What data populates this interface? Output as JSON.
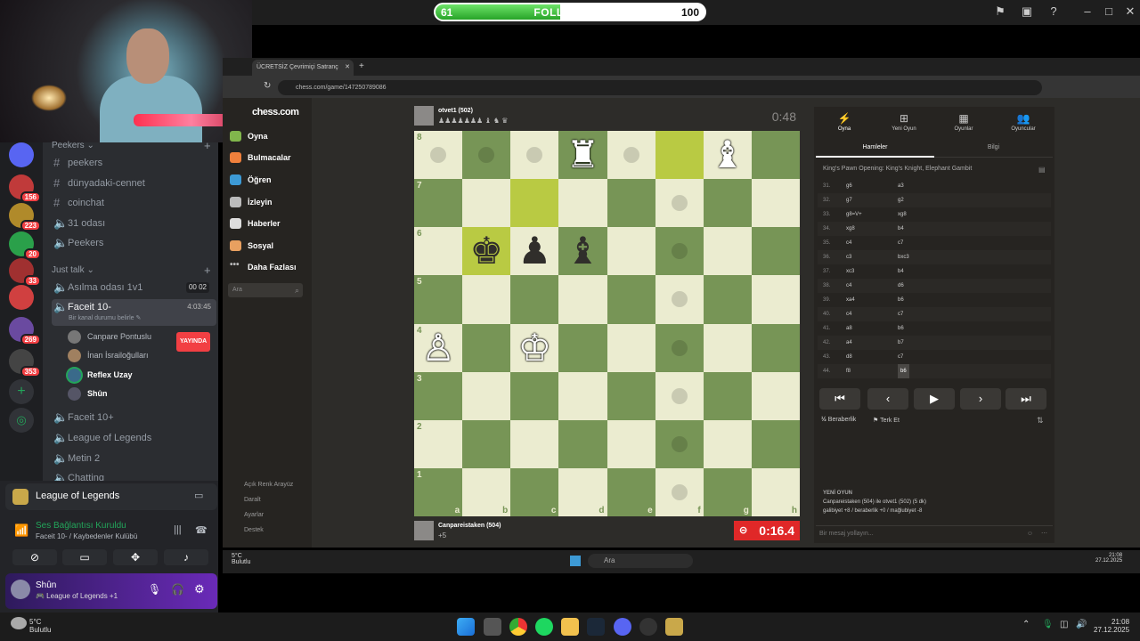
{
  "overlay": {
    "followers_min": "61",
    "followers_label": "FOLLOWERS",
    "followers_max": "100",
    "followers_progress": 0.465,
    "bar_colors": {
      "fill": "#4cc34a",
      "border": "#ffffff"
    }
  },
  "discord": {
    "categories": [
      {
        "label": "Peekers ⌄"
      },
      {
        "label": "Just talk ⌄"
      }
    ],
    "text_channels": [
      "peekers",
      "dünyadaki-cennet",
      "coinchat",
      "31 odası",
      "Peekers"
    ],
    "voice_channels_top": [
      {
        "label": "Asılma odası 1v1",
        "count_a": "00",
        "count_b": "02"
      },
      {
        "label": "Faceit 10-",
        "timer": "4:03:45",
        "status": "Bir kanal durumu belirle ✎"
      }
    ],
    "voice_users": [
      {
        "name": "Canpare Pontuslu",
        "live": "YAYINDA"
      },
      {
        "name": "İnan İsrailoğulları"
      },
      {
        "name": "Reflex Uzay"
      },
      {
        "name": "Shûn"
      }
    ],
    "voice_channels_bottom": [
      "Faceit 10+",
      "League of Legends",
      "Metin 2",
      "Chatting"
    ],
    "server_badges": [
      "156",
      "223",
      "20",
      "33",
      "269",
      "353"
    ],
    "activity": "League of Legends",
    "connection": {
      "title": "Ses Bağlantısı Kuruldu",
      "subtitle": "Faceit 10- / Kaybedenler Kulübü"
    },
    "user": {
      "name": "Shûn",
      "status": "🎮 League of Legends +1"
    }
  },
  "browser": {
    "tab_title": "ÜCRETSİZ Çevrimiçi Satranç",
    "url": "chess.com/game/147250789086"
  },
  "chess_nav": {
    "logo": "chess.com",
    "items": [
      "Oyna",
      "Bulmacalar",
      "Öğren",
      "İzleyin",
      "Haberler",
      "Sosyal",
      "Daha Fazlası"
    ],
    "search_placeholder": "Ara",
    "bottom": [
      "Açık Renk Arayüz",
      "Daralt",
      "Ayarlar",
      "Destek"
    ]
  },
  "game": {
    "top_player": {
      "name": "otvet1 (502)",
      "material": "♟♟♟♟♟♟♟ ♝ ♞ ♛"
    },
    "top_clock": "0:48",
    "bottom_player": {
      "name": "Canpareistaken (504)",
      "material": "+5"
    },
    "bottom_clock": "0:16.4",
    "ranks": [
      "8",
      "7",
      "6",
      "5",
      "4",
      "3",
      "2",
      "1"
    ],
    "files": [
      "a",
      "b",
      "c",
      "d",
      "e",
      "f",
      "g",
      "h"
    ],
    "pieces": [
      {
        "sq": "d8",
        "glyph": "♜",
        "color": "w"
      },
      {
        "sq": "g8",
        "glyph": "♝",
        "color": "w"
      },
      {
        "sq": "b6",
        "glyph": "♚",
        "color": "b"
      },
      {
        "sq": "c6",
        "glyph": "♟",
        "color": "b"
      },
      {
        "sq": "d6",
        "glyph": "♝",
        "color": "b"
      },
      {
        "sq": "a4",
        "glyph": "♙",
        "color": "w"
      },
      {
        "sq": "c4",
        "glyph": "♔",
        "color": "w"
      }
    ],
    "highlights": [
      "f8",
      "c7",
      "b6"
    ],
    "move_dots": [
      "a8",
      "b8",
      "c8",
      "e8",
      "f7",
      "f6",
      "f5",
      "f4",
      "f3",
      "f2",
      "f1"
    ]
  },
  "panel": {
    "tabs": [
      "Oyna",
      "Yeni Oyun",
      "Oyunlar",
      "Oyuncular"
    ],
    "subtabs": [
      "Hamleler",
      "Bilgi"
    ],
    "opening": "King's Pawn Opening: King's Knight, Elephant Gambit",
    "moves": [
      {
        "n": "31.",
        "w": "g6",
        "b": "a3"
      },
      {
        "n": "32.",
        "w": "g7",
        "b": "g2"
      },
      {
        "n": "33.",
        "w": "g8=V+",
        "b": "xg8"
      },
      {
        "n": "34.",
        "w": "xg8",
        "b": "b4"
      },
      {
        "n": "35.",
        "w": "c4",
        "b": "c7"
      },
      {
        "n": "36.",
        "w": "c3",
        "b": "bxc3"
      },
      {
        "n": "37.",
        "w": "xc3",
        "b": "b4"
      },
      {
        "n": "38.",
        "w": "c4",
        "b": "d6"
      },
      {
        "n": "39.",
        "w": "xa4",
        "b": "b6"
      },
      {
        "n": "40.",
        "w": "c4",
        "b": "c7"
      },
      {
        "n": "41.",
        "w": "a8",
        "b": "b6"
      },
      {
        "n": "42.",
        "w": "a4",
        "b": "b7"
      },
      {
        "n": "43.",
        "w": "d8",
        "b": "c7"
      },
      {
        "n": "44.",
        "w": "f8",
        "b": "b6"
      }
    ],
    "draw": "Beraberlik",
    "resign": "Terk Et",
    "new_game_title": "YENİ OYUN",
    "new_game_line1": "Canpareistaken (504) ile otvet1 (502) (5 dk)",
    "new_game_line2": "galibiyet +8 / beraberlik +0 / mağlubiyet -8",
    "message_placeholder": "Bir mesaj yollayın..."
  },
  "inner_taskbar": {
    "weather": "5°C",
    "weather_sub": "Bulutlu",
    "search": "Ara",
    "time": "21:08",
    "date": "27.12.2025"
  },
  "taskbar": {
    "weather": "5°C",
    "weather_sub": "Bulutlu",
    "time": "21:08",
    "date": "27.12.2025"
  }
}
